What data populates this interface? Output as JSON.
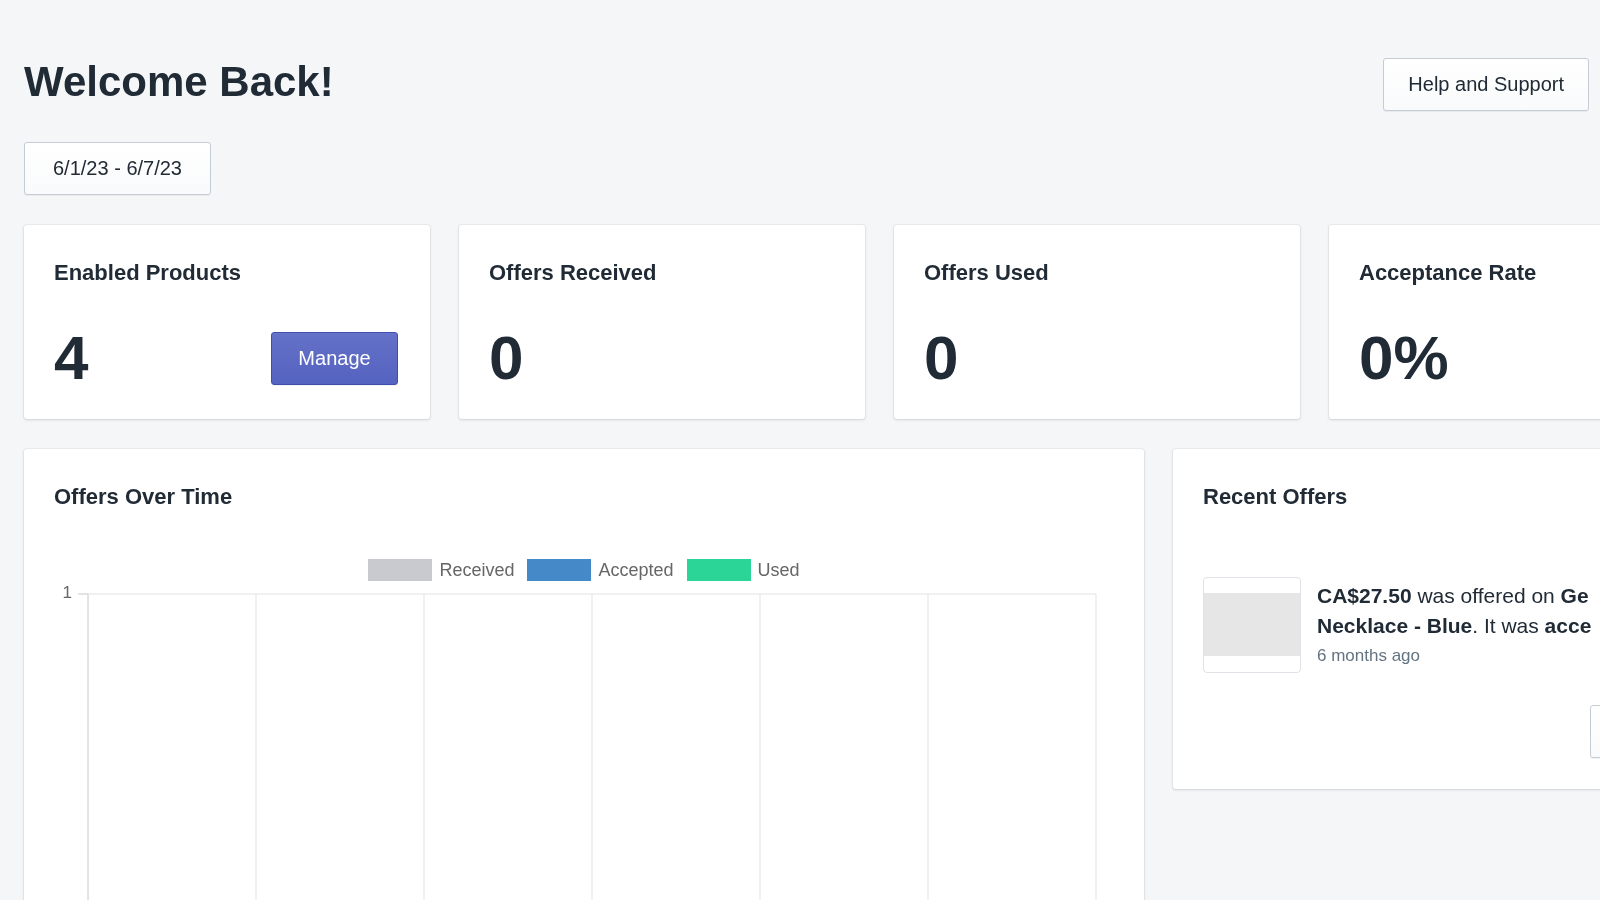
{
  "header": {
    "title": "Welcome Back!",
    "help_button": "Help and Support"
  },
  "date_range_button": {
    "label": "6/1/23 - 6/7/23"
  },
  "stats": [
    {
      "title": "Enabled Products",
      "value": "4",
      "action": "Manage"
    },
    {
      "title": "Offers Received",
      "value": "0"
    },
    {
      "title": "Offers Used",
      "value": "0"
    },
    {
      "title": "Acceptance Rate",
      "value": "0%"
    }
  ],
  "offers_chart": {
    "title": "Offers Over Time",
    "legend": [
      {
        "label": "Received",
        "color": "#c9cacf"
      },
      {
        "label": "Accepted",
        "color": "#4689c9"
      },
      {
        "label": "Used",
        "color": "#2bd597"
      }
    ],
    "y_tick": "1"
  },
  "recent_offers": {
    "title": "Recent Offers",
    "items": [
      {
        "lines": [
          "**CA$27.50** was offered on **Ge**",
          "**Necklace - Blue**. It was **acce**"
        ],
        "time": "6 months ago"
      }
    ]
  }
}
